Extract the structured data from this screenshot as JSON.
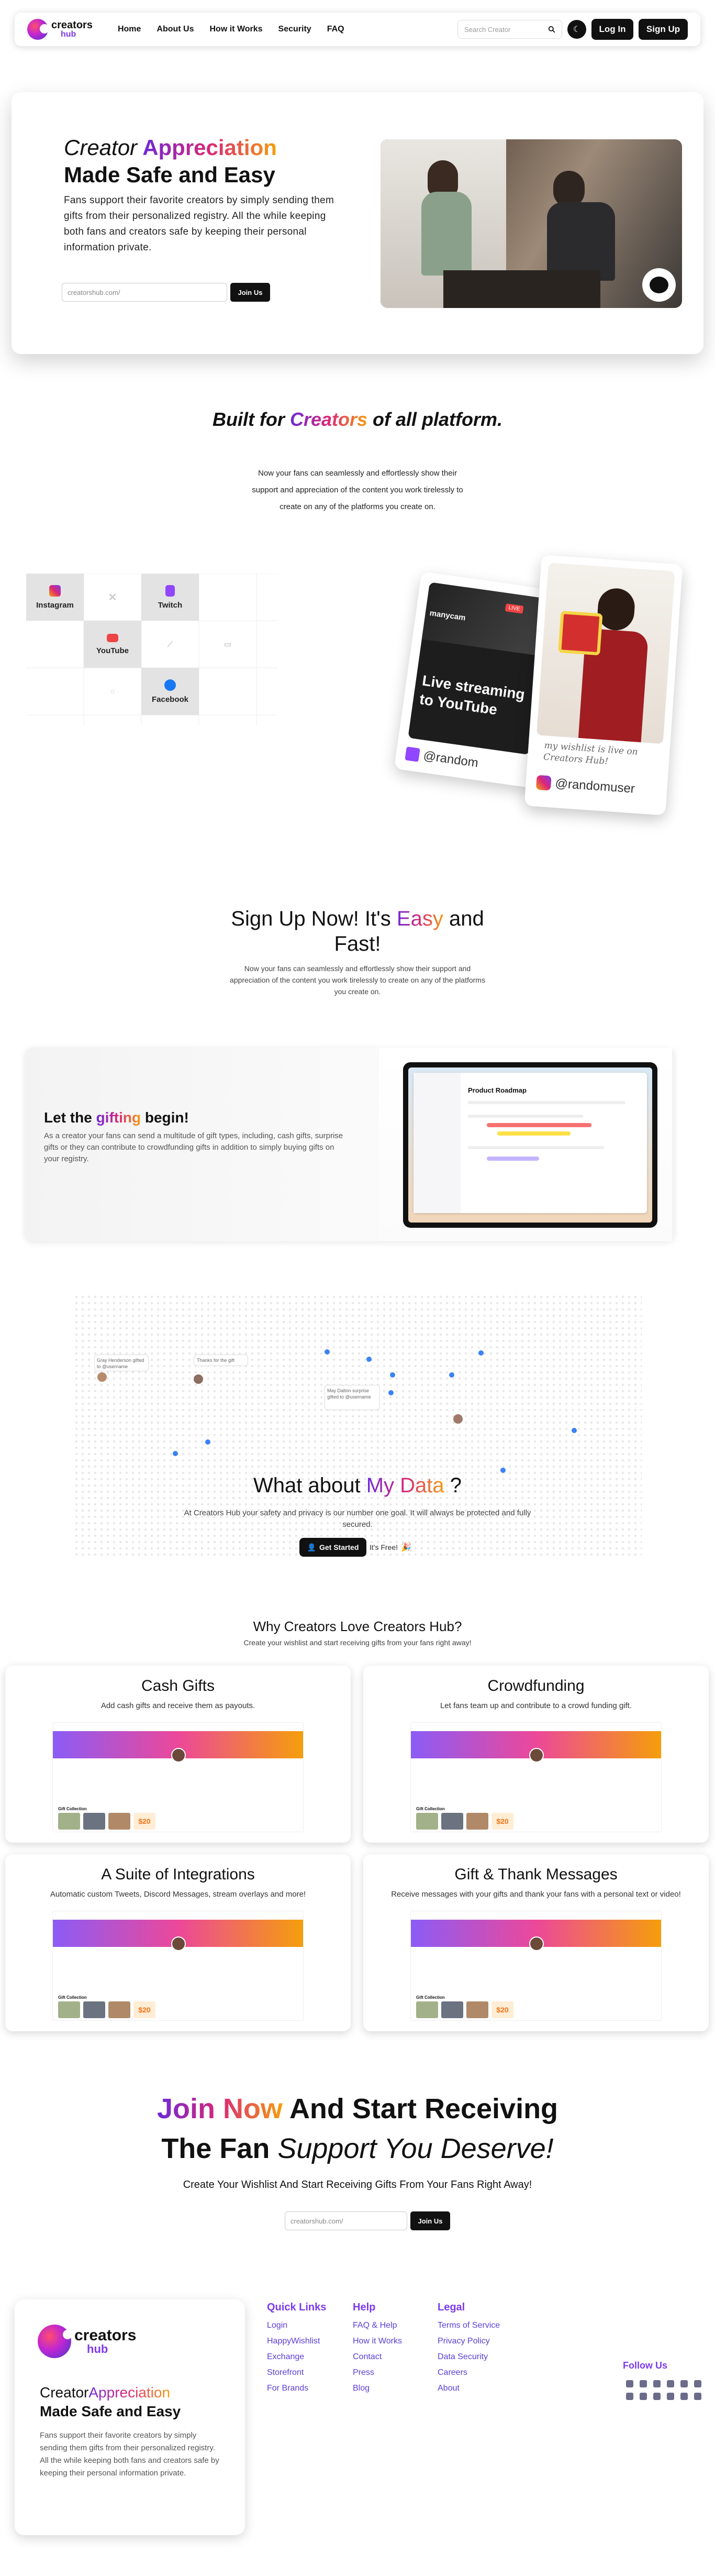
{
  "nav": {
    "logo_top": "creators",
    "logo_bottom": "hub",
    "links": [
      "Home",
      "About Us",
      "How it Works",
      "Security",
      "FAQ"
    ],
    "search_placeholder": "Search Creator",
    "login": "Log In",
    "signup": "Sign Up"
  },
  "hero": {
    "title_a": "Creator",
    "title_b": "Appreciation",
    "title_c": "Made Safe and Easy",
    "body": "Fans support their favorite creators by simply sending them gifts from their personalized registry. All the while keeping both fans and creators safe by keeping their personal information private.",
    "input_placeholder": "creatorshub.com/",
    "cta": "Join Us"
  },
  "built": {
    "title_a": "Built for",
    "title_b": "Creators",
    "title_c": "of all platform.",
    "body": "Now your fans can seamlessly and effortlessly show their support and appreciation of the content you work tirelessly to create on any of the platforms you create on."
  },
  "platforms": [
    "Instagram",
    "Twitch",
    "YouTube",
    "Facebook"
  ],
  "social_cards": {
    "stream_brand": "manycam",
    "stream_badge": "LIVE",
    "stream_text": "Live streaming to YouTube",
    "stream_handle": "@random",
    "wish_text": "my wishlist is live on Creators Hub!",
    "wish_handle": "@randomuser"
  },
  "signup": {
    "title_a": "Sign Up Now! It's",
    "title_b": "Easy",
    "title_c": "and",
    "title_d": "Fast!",
    "body": "Now your fans can seamlessly and effortlessly show their support and appreciation of the content you work tirelessly to create on any of the platforms you create on."
  },
  "gifting": {
    "title_a": "Let the",
    "title_b": "gifting",
    "title_c": "begin!",
    "body": "As a creator your fans can send a multitude of gift types, including, cash gifts, surprise gifts or they can contribute to crowdfunding gifts in addition to simply buying gifts on your registry.",
    "screen_title": "Product Roadmap"
  },
  "data": {
    "bubbles": [
      "Gray Henderson gifted to @username",
      "Thanks for the gift",
      "May Dalton surprise gifted to @username"
    ],
    "title_a": "What about",
    "title_b": "My Data",
    "title_c": "?",
    "body": "At Creators Hub your safety and privacy is our number one goal. It will always be protected and fully secured.",
    "cta": "Get Started",
    "free": "It's Free!"
  },
  "why": {
    "title": "Why Creators Love Creators Hub?",
    "subtitle": "Create your wishlist and start receiving gifts from your fans right away!",
    "features": [
      {
        "title": "Cash Gifts",
        "desc": "Add cash gifts and receive them as payouts."
      },
      {
        "title": "Crowdfunding",
        "desc": "Let fans team up and contribute to a crowd funding gift."
      },
      {
        "title": "A Suite of Integrations",
        "desc": "Automatic custom Tweets, Discord Messages, stream overlays and more!"
      },
      {
        "title": "Gift & Thank Messages",
        "desc": "Receive messages with your gifts and thank your fans with a personal text or video!"
      }
    ],
    "mock_section": "Gift Collection",
    "mock_price": "$20"
  },
  "join": {
    "line1_a": "Join Now",
    "line1_b": "And Start Receiving",
    "line2_a": "The Fan",
    "line2_b": "Support You Deserve!",
    "subtitle": "Create Your Wishlist And Start Receiving Gifts From Your Fans Right Away!",
    "input_placeholder": "creatorshub.com/",
    "cta": "Join Us"
  },
  "footer": {
    "title_a": "Creator",
    "title_b": "Appreciation",
    "title_c": "Made Safe and Easy",
    "body": "Fans support their favorite creators by simply sending them gifts from their personalized registry. All the while keeping both fans and creators safe by keeping their personal information private.",
    "quick_links": {
      "title": "Quick Links",
      "items": [
        "Login",
        "HappyWishlist",
        "Exchange",
        "Storefront",
        "For Brands"
      ]
    },
    "help": {
      "title": "Help",
      "items": [
        "FAQ & Help",
        "How it Works",
        "Contact",
        "Press",
        "Blog"
      ]
    },
    "legal": {
      "title": "Legal",
      "items": [
        "Terms of Service",
        "Privacy Policy",
        "Data Security",
        "Careers",
        "About"
      ]
    },
    "follow": "Follow Us"
  },
  "colors": {
    "accent": "#7c3aed",
    "pink": "#db2777",
    "orange": "#f59e0b",
    "dark": "#111111"
  }
}
